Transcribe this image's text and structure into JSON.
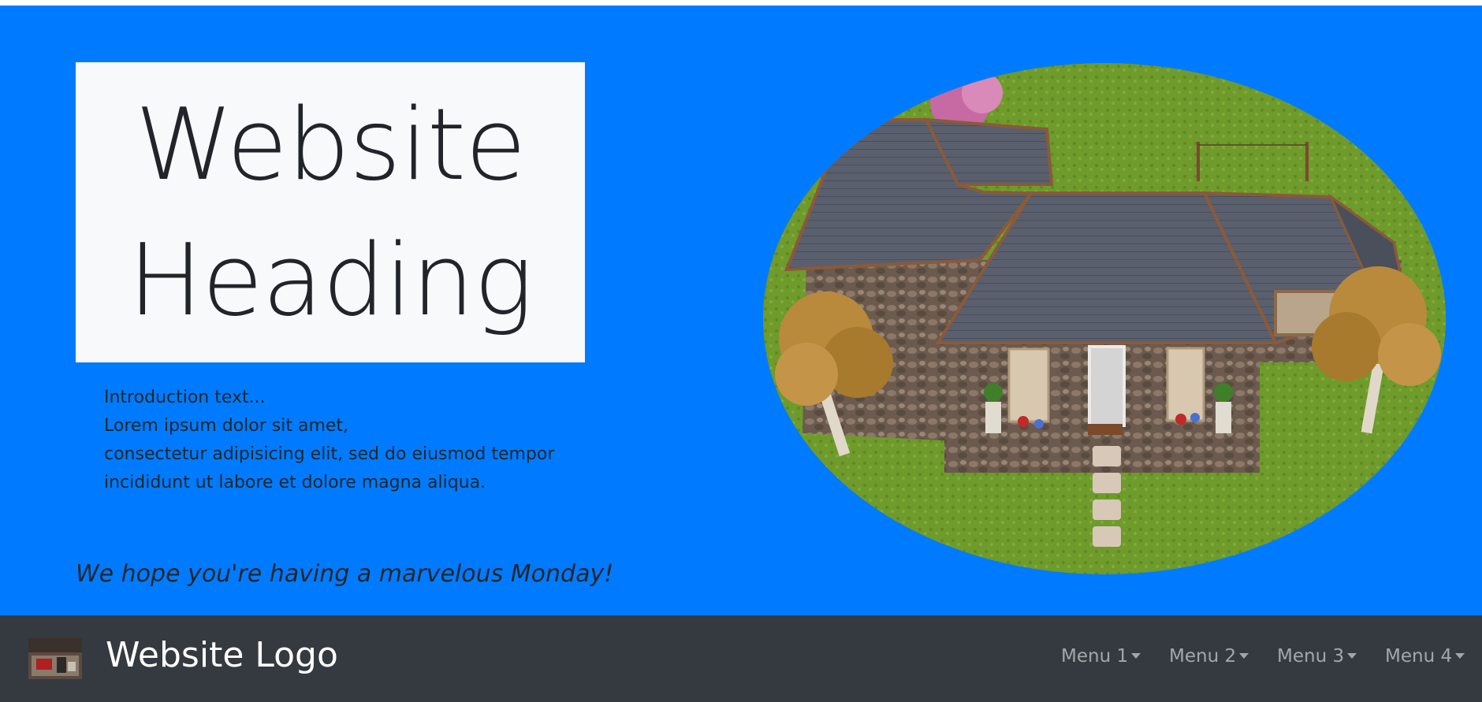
{
  "hero": {
    "heading_line1": "Website",
    "heading_line2": "Heading",
    "intro_lines": [
      "Introduction text...",
      "Lorem ipsum dolor sit amet,",
      "consectetur adipisicing elit, sed do eiusmod tempor",
      "incididunt ut labore et dolore magna aliqua."
    ],
    "greeting": "We hope you're having a marvelous Monday!",
    "image_icon": "house-image"
  },
  "navbar": {
    "logo_icon": "logo-image",
    "brand": "Website Logo",
    "menus": [
      "Menu 1",
      "Menu 2",
      "Menu 3",
      "Menu 4"
    ]
  },
  "colors": {
    "hero_background": "#007bff",
    "heading_box": "#f8f9fa",
    "text": "#212529",
    "navbar_background": "#343a40",
    "nav_link": "rgba(255,255,255,0.55)"
  }
}
